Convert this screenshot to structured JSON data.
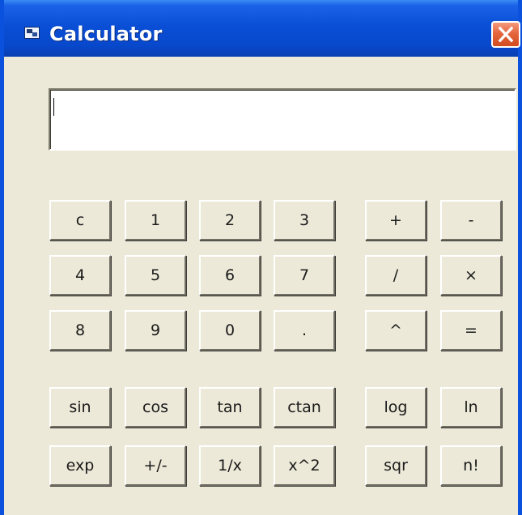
{
  "window": {
    "title": "Calculator"
  },
  "display": {
    "value": ""
  },
  "buttons": {
    "clear": "c",
    "one": "1",
    "two": "2",
    "three": "3",
    "plus": "+",
    "minus": "-",
    "four": "4",
    "five": "5",
    "six": "6",
    "seven": "7",
    "divide": "/",
    "multiply": "×",
    "eight": "8",
    "nine": "9",
    "zero": "0",
    "decimal": ".",
    "power": "^",
    "equals": "=",
    "sin": "sin",
    "cos": "cos",
    "tan": "tan",
    "ctan": "ctan",
    "log": "log",
    "ln": "ln",
    "exp": "exp",
    "negate": "+/-",
    "reciprocal": "1/x",
    "square": "x^2",
    "sqr": "sqr",
    "factorial": "n!"
  },
  "colors": {
    "titlebar": "#0a4fd6",
    "window_bg": "#ece9d8",
    "close_button": "#e5663d"
  },
  "icons": {
    "app": "calculator-app-icon",
    "close": "close-icon"
  }
}
